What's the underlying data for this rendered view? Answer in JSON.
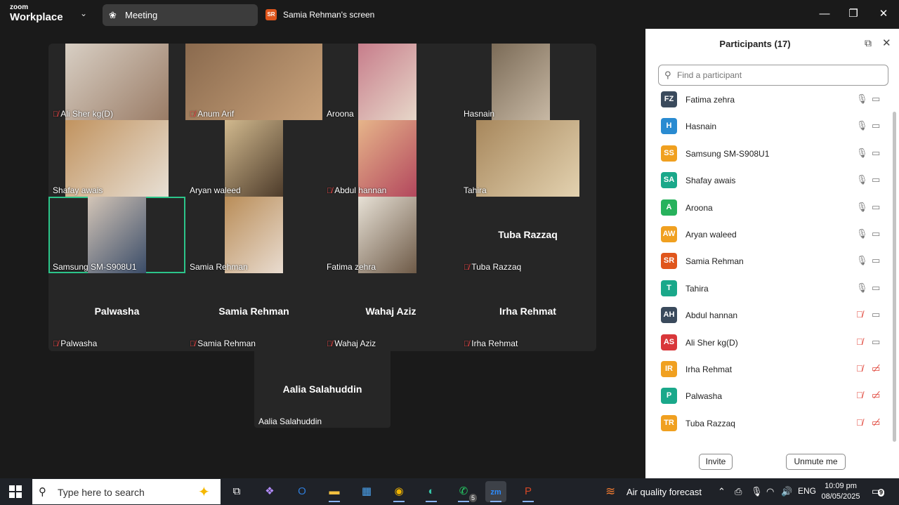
{
  "titlebar": {
    "logo_line1": "zoom",
    "logo_line2": "Workplace",
    "tab_meeting": "Meeting",
    "share_badge": "SR",
    "share_label": "Samia Rehman's screen"
  },
  "colors": {
    "active_speaker_border": "#2cc58a",
    "muted_red": "#e0453a",
    "panel_bg": "#ffffff",
    "gallery_bg": "#262626"
  },
  "gallery": {
    "tiles": [
      {
        "name": "Ali Sher kg(D)",
        "muted": true,
        "video": true,
        "bg": "linear-gradient(135deg,#d8cfc4,#9a7c66)"
      },
      {
        "name": "Anum Arif",
        "muted": true,
        "video": true,
        "bg": "linear-gradient(135deg,#8a6a4e,#c9a27a)"
      },
      {
        "name": "Aroona",
        "muted": false,
        "video": true,
        "bg": "linear-gradient(135deg,#c77d8b,#e7d7c9)"
      },
      {
        "name": "Hasnain",
        "muted": false,
        "video": true,
        "bg": "linear-gradient(135deg,#7b6b57,#c7b8a4)"
      },
      {
        "name": "Shafay awais",
        "muted": false,
        "video": true,
        "bg": "linear-gradient(135deg,#c1935f,#e8e0d5)"
      },
      {
        "name": "Aryan waleed",
        "muted": false,
        "video": true,
        "bg": "linear-gradient(135deg,#d1b98e,#4d3b2a)"
      },
      {
        "name": "Abdul hannan",
        "muted": true,
        "video": true,
        "bg": "linear-gradient(135deg,#e6b58a,#b3475d)"
      },
      {
        "name": "Tahira",
        "muted": false,
        "video": true,
        "bg": "linear-gradient(135deg,#a7875c,#e3d2b0)"
      },
      {
        "name": "Samsung SM-S908U1",
        "muted": false,
        "video": true,
        "active": true,
        "bg": "linear-gradient(135deg,#d3c5b7,#3a4c68)"
      },
      {
        "name": "Samia Rehman",
        "muted": false,
        "video": true,
        "bg": "linear-gradient(135deg,#b98d58,#e9dcd0)"
      },
      {
        "name": "Fatima zehra",
        "muted": false,
        "video": true,
        "bg": "linear-gradient(135deg,#e7e1d6,#6e5a47)"
      },
      {
        "name": "Tuba Razzaq",
        "muted": true,
        "video": false,
        "display_name": "Tuba Razzaq"
      },
      {
        "name": "Palwasha",
        "muted": true,
        "video": false,
        "display_name": "Palwasha"
      },
      {
        "name": "Samia Rehman",
        "muted": true,
        "video": false,
        "display_name": "Samia Rehman"
      },
      {
        "name": "Wahaj Aziz",
        "muted": true,
        "video": false,
        "display_name": "Wahaj Aziz"
      },
      {
        "name": "Irha Rehmat",
        "muted": true,
        "video": false,
        "display_name": "Irha Rehmat"
      }
    ],
    "extra_tile": {
      "name": "Aalia Salahuddin",
      "display_name": "Aalia Salahuddin"
    }
  },
  "panel": {
    "title": "Participants (17)",
    "search_placeholder": "Find a participant",
    "participants": [
      {
        "initials": "FZ",
        "name": "Fatima zehra",
        "color": "#3a4a5c",
        "mic_muted": false,
        "cam_off": false
      },
      {
        "initials": "H",
        "name": "Hasnain",
        "color": "#2a8bd1",
        "mic_muted": false,
        "cam_off": false
      },
      {
        "initials": "SS",
        "name": "Samsung SM-S908U1",
        "color": "#f0a020",
        "mic_muted": false,
        "cam_off": false
      },
      {
        "initials": "SA",
        "name": "Shafay awais",
        "color": "#1aa88a",
        "mic_muted": false,
        "cam_off": false
      },
      {
        "initials": "A",
        "name": "Aroona",
        "color": "#27b25c",
        "mic_muted": false,
        "cam_off": false
      },
      {
        "initials": "AW",
        "name": "Aryan waleed",
        "color": "#f0a020",
        "mic_muted": false,
        "cam_off": false
      },
      {
        "initials": "SR",
        "name": "Samia Rehman",
        "color": "#e0561c",
        "mic_muted": false,
        "cam_off": false
      },
      {
        "initials": "T",
        "name": "Tahira",
        "color": "#1aa88a",
        "mic_muted": false,
        "cam_off": false
      },
      {
        "initials": "AH",
        "name": "Abdul hannan",
        "color": "#3a4a5c",
        "mic_muted": true,
        "cam_off": false
      },
      {
        "initials": "AS",
        "name": "Ali Sher kg(D)",
        "color": "#d9373a",
        "mic_muted": true,
        "cam_off": false
      },
      {
        "initials": "IR",
        "name": "Irha Rehmat",
        "color": "#f0a020",
        "mic_muted": true,
        "cam_off": true
      },
      {
        "initials": "P",
        "name": "Palwasha",
        "color": "#1aa88a",
        "mic_muted": true,
        "cam_off": true
      },
      {
        "initials": "TR",
        "name": "Tuba Razzaq",
        "color": "#f0a020",
        "mic_muted": true,
        "cam_off": true
      }
    ],
    "invite_label": "Invite",
    "unmute_label": "Unmute me"
  },
  "taskbar": {
    "search_text": "Type here to search",
    "weather_text": "Air quality forecast",
    "lang": "ENG",
    "time": "10:09 pm",
    "date": "08/05/2025",
    "notification_count": "9",
    "whatsapp_count": "5",
    "apps": [
      {
        "icon": "task-view-icon",
        "glyph": "⧉",
        "color": "#ffffff"
      },
      {
        "icon": "copilot-icon",
        "glyph": "❖",
        "color": "#b38cff"
      },
      {
        "icon": "outlook-icon",
        "glyph": "O",
        "color": "#2e7bd6"
      },
      {
        "icon": "file-explorer-icon",
        "glyph": "▬",
        "color": "#f3c03f"
      },
      {
        "icon": "store-icon",
        "glyph": "▦",
        "color": "#4aa3f0"
      },
      {
        "icon": "chrome-icon",
        "glyph": "◉",
        "color": "#f0b400"
      },
      {
        "icon": "edge-icon",
        "glyph": "◐",
        "color": "#36c5a8"
      },
      {
        "icon": "whatsapp-icon",
        "glyph": "✆",
        "color": "#25d366"
      },
      {
        "icon": "zoom-icon",
        "glyph": "zm",
        "color": "#2d8cff"
      },
      {
        "icon": "powerpoint-icon",
        "glyph": "P",
        "color": "#d24726"
      }
    ]
  }
}
